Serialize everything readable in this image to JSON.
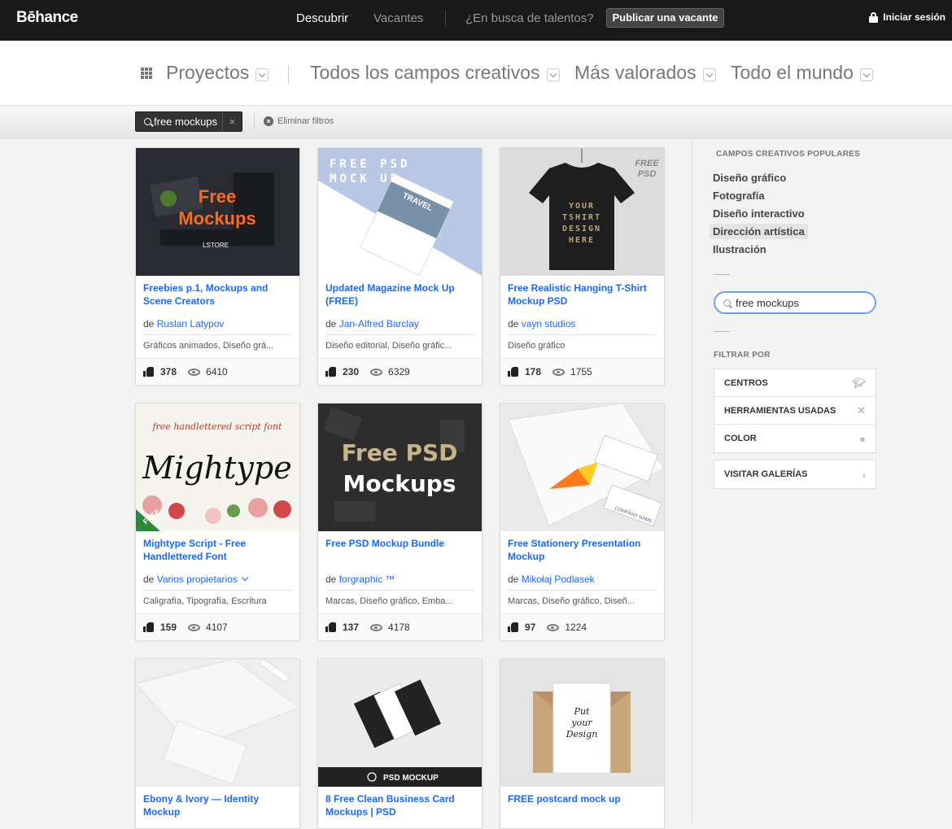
{
  "topbar": {
    "logo": "Bēhance",
    "nav": [
      "Descubrir",
      "Vacantes",
      "¿En busca de talentos?"
    ],
    "post_button": "Publicar una vacante",
    "login": "Iniciar sesión"
  },
  "filters": {
    "selects": [
      "Proyectos",
      "Todos los campos creativos",
      "Más valorados",
      "Todo el mundo"
    ]
  },
  "tagbar": {
    "tag": "free mockups",
    "tag_close": "×",
    "clear": "Eliminar filtros",
    "clear_icon": "×"
  },
  "projects": [
    {
      "title": "Freebies p.1, Mockups and Scene Creators",
      "owner_prefix": "de",
      "owner": "Ruslan Latypov",
      "fields": "Gráficos animados, Diseño grá...",
      "likes": "378",
      "views": "6410"
    },
    {
      "title": "Updated Magazine Mock Up (FREE)",
      "owner_prefix": "de",
      "owner": "Jan-Alfred Barclay",
      "fields": "Diseño editorial, Diseño gráfic...",
      "likes": "230",
      "views": "6329"
    },
    {
      "title": "Free Realistic Hanging T-Shirt Mockup PSD",
      "owner_prefix": "de",
      "owner": "vayn studios",
      "fields": "Diseño gráfico",
      "likes": "178",
      "views": "1755"
    },
    {
      "title": "Mightype Script - Free Handlettered Font",
      "owner_prefix": "de",
      "owner": "Varios propietarios",
      "fields": "Caligrafía, Tipografía, Escritura",
      "likes": "159",
      "views": "4107"
    },
    {
      "title": "Free PSD Mockup Bundle",
      "owner_prefix": "de",
      "owner": "forgraphic ™",
      "fields": "Marcas, Diseño gráfico, Emba...",
      "likes": "137",
      "views": "4178"
    },
    {
      "title": "Free Stationery Presentation Mockup",
      "owner_prefix": "de",
      "owner": "Mikołaj Podlasek",
      "fields": "Marcas, Diseño gráfico, Diseñ...",
      "likes": "97",
      "views": "1224"
    },
    {
      "title": "Ebony & Ivory — Identity Mockup"
    },
    {
      "title": "8 Free Clean Business Card Mockups | PSD"
    },
    {
      "title": "FREE postcard mock up"
    }
  ],
  "thumb_text": {
    "t1_a": "Free",
    "t1_b": "Mockups",
    "t1_c": "LSTORE",
    "t2_a": "FREE PSD",
    "t2_b": "MOCK UP",
    "t2_c": "TRAVEL",
    "t3_a": "FREE",
    "t3_b": "PSD",
    "t3_c": "YOUR",
    "t3_d": "TSHIRT",
    "t3_e": "DESIGN",
    "t3_f": "HERE",
    "t4_a": "free handlettered script font",
    "t4_b": "Mightype",
    "t4_c": "FREE",
    "t5_a": "Free PSD",
    "t5_b": "Mockups",
    "t6_a": "COMPANY NAME",
    "t8_a": "PSD MOCKUP",
    "t9_a": "Put",
    "t9_b": "your",
    "t9_c": "Design"
  },
  "sidebar": {
    "popular_heading": "CAMPOS CREATIVOS POPULARES",
    "popular": [
      "Diseño gráfico",
      "Fotografía",
      "Diseño interactivo",
      "Dirección artística",
      "Ilustración"
    ],
    "search_value": "free mockups",
    "filter_heading": "FILTRAR POR",
    "filters": [
      "CENTROS",
      "HERRAMIENTAS USADAS",
      "COLOR"
    ],
    "galleries": "VISITAR GALERÍAS"
  },
  "colors": {
    "link": "#1769ff",
    "topbar": "#191919",
    "accent_orange": "#ff6a1a"
  }
}
